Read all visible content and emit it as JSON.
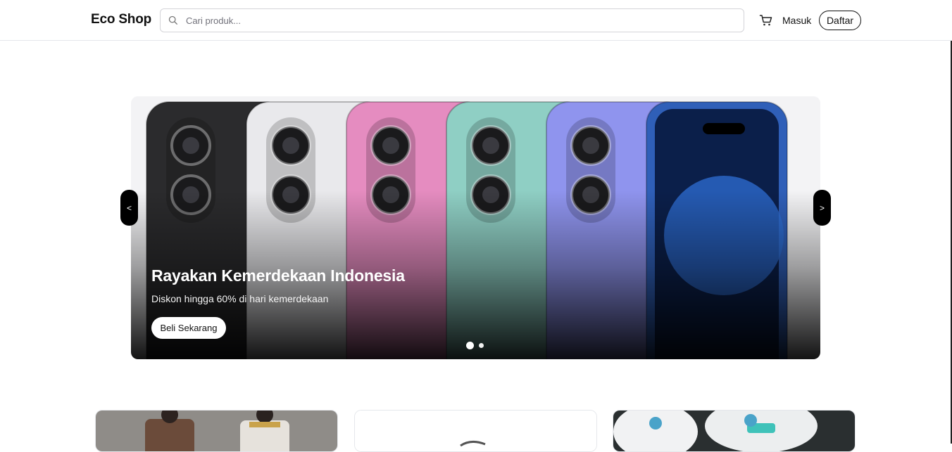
{
  "header": {
    "logo": "Eco Shop",
    "search_placeholder": "Cari produk...",
    "login_label": "Masuk",
    "register_label": "Daftar",
    "icons": {
      "search": "search-icon",
      "cart": "cart-icon"
    }
  },
  "hero": {
    "title": "Rayakan Kemerdekaan Indonesia",
    "subtitle": "Diskon hingga 60% di hari kemerdekaan",
    "cta_label": "Beli Sekarang",
    "prev_label": "<",
    "next_label": ">",
    "slides_count": 2,
    "active_slide": 1,
    "phone_colors": [
      "#2b2b2d",
      "#e9e9ec",
      "#e58cc0",
      "#8fcfc4",
      "#8f94ee",
      "#2f5fb8"
    ]
  },
  "categories": [
    {
      "name": "product-card-batik"
    },
    {
      "name": "product-card-watch"
    },
    {
      "name": "product-card-shoes"
    }
  ]
}
